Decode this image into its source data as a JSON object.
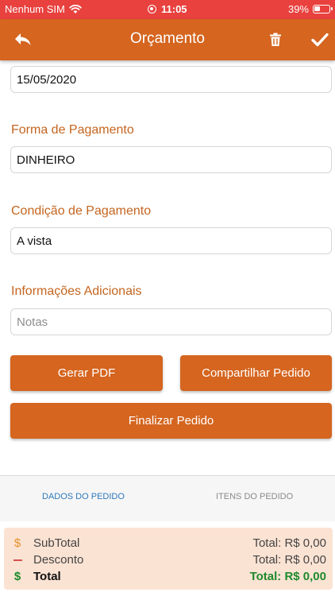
{
  "status_bar": {
    "carrier": "Nenhum SIM",
    "time": "11:05",
    "battery": "39%",
    "battery_level": 0.39
  },
  "nav": {
    "title": "Orçamento",
    "back_icon": "back-arrow-icon",
    "trash_icon": "trash-icon",
    "check_icon": "check-icon"
  },
  "form": {
    "date_value": "15/05/2020",
    "payment_method": {
      "label": "Forma de Pagamento",
      "value": "DINHEIRO"
    },
    "payment_condition": {
      "label": "Condição de Pagamento",
      "value": "A vista"
    },
    "additional_info": {
      "label": "Informações Adicionais",
      "placeholder": "Notas"
    }
  },
  "actions": {
    "generate_pdf": "Gerar PDF",
    "share_order": "Compartilhar Pedido",
    "finalize_order": "Finalizar Pedido"
  },
  "tabs": {
    "order_data": "DADOS DO PEDIDO",
    "order_items": "ITENS DO PEDIDO"
  },
  "totals": {
    "subtotal": {
      "symbol": "$",
      "label": "SubTotal",
      "value": "Total: R$ 0,00"
    },
    "discount": {
      "label": "Desconto",
      "value": "Total: R$ 0,00"
    },
    "total": {
      "symbol": "$",
      "label": "Total",
      "value": "Total: R$ 0,00"
    }
  },
  "colors": {
    "status_bar": "#e8413e",
    "primary": "#d5651f",
    "label": "#c4651f",
    "tab_active": "#2f79bd",
    "totals_bg": "#fbe3d3",
    "subtotal_symbol": "#e3922b",
    "discount_symbol": "#d85050",
    "total_green": "#1e8a2c"
  }
}
